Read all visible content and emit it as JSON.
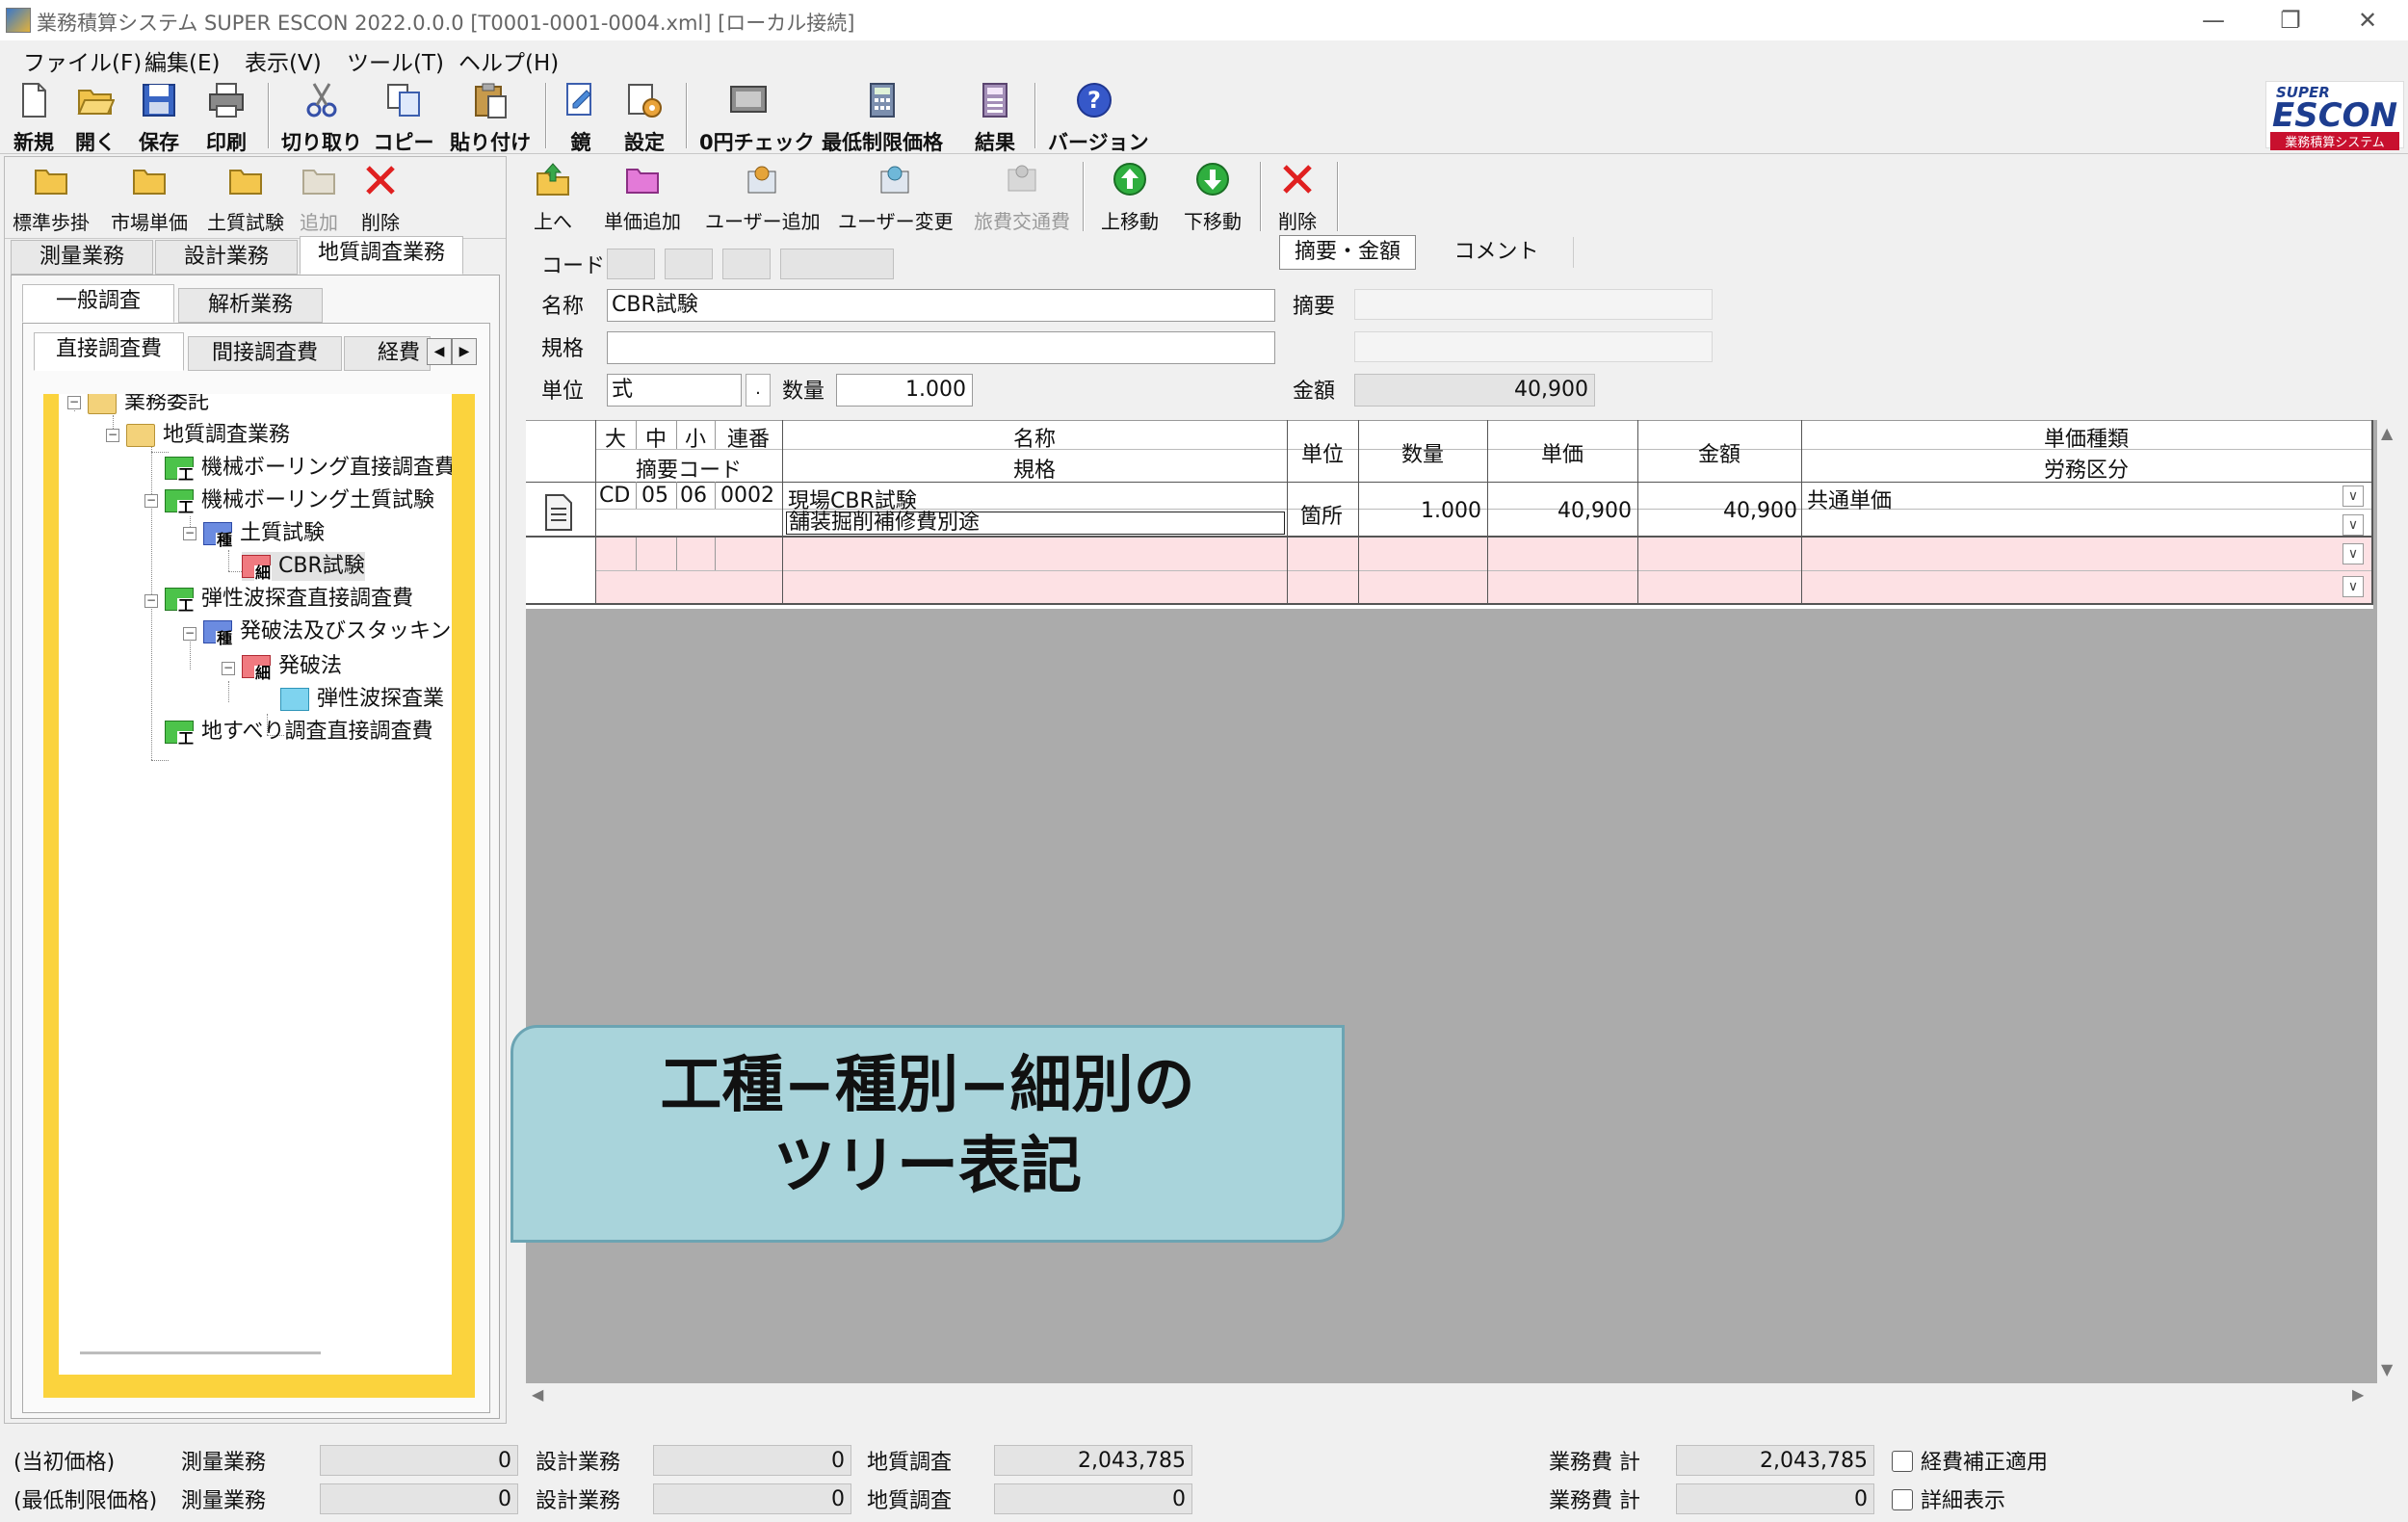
{
  "window": {
    "title": "業務積算システム SUPER ESCON 2022.0.0.0 [T0001-0001-0004.xml] [ローカル接続]",
    "controls": {
      "minimize": "—",
      "restore": "❐",
      "close": "✕"
    }
  },
  "menu": [
    "ファイル(F)",
    "編集(E)",
    "表示(V)",
    "ツール(T)",
    "ヘルプ(H)"
  ],
  "toolbar": [
    {
      "label": "新規",
      "icon": "new-file-icon"
    },
    {
      "label": "開く",
      "icon": "open-folder-icon"
    },
    {
      "label": "保存",
      "icon": "save-icon"
    },
    {
      "label": "印刷",
      "icon": "print-icon"
    },
    {
      "label": "切り取り",
      "icon": "scissors-icon"
    },
    {
      "label": "コピー",
      "icon": "copy-icon"
    },
    {
      "label": "貼り付け",
      "icon": "paste-icon"
    },
    {
      "label": "鏡",
      "icon": "mirror-icon"
    },
    {
      "label": "設定",
      "icon": "settings-icon"
    },
    {
      "label": "0円チェック",
      "icon": "zero-yen-check-icon"
    },
    {
      "label": "最低制限価格",
      "icon": "calculator-icon"
    },
    {
      "label": "結果",
      "icon": "result-icon"
    },
    {
      "label": "バージョン",
      "icon": "help-icon"
    }
  ],
  "logo": {
    "line1": "SUPER",
    "line2": "ESCON",
    "line3": "業務積算システム"
  },
  "left": {
    "subtoolbar": [
      {
        "label": "標準歩掛",
        "icon": "folder-icon",
        "disabled": false
      },
      {
        "label": "市場単価",
        "icon": "folder-icon",
        "disabled": false
      },
      {
        "label": "土質試験",
        "icon": "folder-icon",
        "disabled": false
      },
      {
        "label": "追加",
        "icon": "folder-icon",
        "disabled": true
      },
      {
        "label": "削除",
        "icon": "delete-icon",
        "disabled": false
      }
    ],
    "tabs1": [
      "測量業務",
      "設計業務",
      "地質調査業務"
    ],
    "tabs2": [
      "一般調査",
      "解析業務"
    ],
    "tabs3": [
      "直接調査費",
      "間接調査費",
      "経費"
    ],
    "tree": [
      {
        "label": "業務委託",
        "kind": "folder",
        "mark": ""
      },
      {
        "label": "地質調査業務",
        "kind": "folder",
        "mark": ""
      },
      {
        "label": "機械ボーリング直接調査費",
        "kind": "green",
        "mark": "工"
      },
      {
        "label": "機械ボーリング土質試験",
        "kind": "green",
        "mark": "工"
      },
      {
        "label": "土質試験",
        "kind": "blue",
        "mark": "種"
      },
      {
        "label": "CBR試験",
        "kind": "red",
        "mark": "細"
      },
      {
        "label": "弾性波探査直接調査費",
        "kind": "green",
        "mark": "工"
      },
      {
        "label": "発破法及びスタッキング",
        "kind": "blue",
        "mark": "種"
      },
      {
        "label": "発破法",
        "kind": "red",
        "mark": "細"
      },
      {
        "label": "弾性波探査業",
        "kind": "lblue",
        "mark": ""
      },
      {
        "label": "地すべり調査直接調査費",
        "kind": "green",
        "mark": "工"
      }
    ]
  },
  "right": {
    "toolbar": [
      {
        "label": "上へ",
        "icon": "up-folder-icon",
        "disabled": false
      },
      {
        "label": "単価追加",
        "icon": "folder-add-icon",
        "disabled": false
      },
      {
        "label": "ユーザー追加",
        "icon": "user-add-icon",
        "disabled": false
      },
      {
        "label": "ユーザー変更",
        "icon": "user-edit-icon",
        "disabled": false
      },
      {
        "label": "旅費交通費",
        "icon": "travel-icon",
        "disabled": true
      },
      {
        "label": "上移動",
        "icon": "arrow-up-icon",
        "disabled": false
      },
      {
        "label": "下移動",
        "icon": "arrow-down-icon",
        "disabled": false
      },
      {
        "label": "削除",
        "icon": "delete-icon",
        "disabled": false
      }
    ],
    "form": {
      "code_label": "コード",
      "name_label": "名称",
      "name_value": "CBR試験",
      "spec_label": "規格",
      "spec_value": "",
      "unit_label": "単位",
      "unit_value": "式",
      "qty_label": "数量",
      "qty_value": "1.000",
      "tabs": [
        "摘要・金額",
        "コメント"
      ],
      "summary_label": "摘要",
      "amount_label": "金額",
      "amount_value": "40,900"
    },
    "grid": {
      "headers": {
        "dai": "大",
        "chu": "中",
        "sho": "小",
        "renban": "連番",
        "code": "摘要コード",
        "name": "名称",
        "spec": "規格",
        "unit": "単位",
        "qty": "数量",
        "price": "単価",
        "amount": "金額",
        "ptype": "単価種類",
        "labor": "労務区分"
      },
      "row": {
        "dai": "CD",
        "chu": "05",
        "sho": "06",
        "renban": "0002",
        "name": "現場CBR試験",
        "spec": "舗装掘削補修費別途",
        "unit": "箇所",
        "qty": "1.000",
        "price": "40,900",
        "amount": "40,900",
        "ptype": "共通単価",
        "labor": ""
      }
    }
  },
  "callout": {
    "line1": "工種−種別−細別の",
    "line2": "ツリー表記"
  },
  "status": {
    "row1": {
      "label": "(当初価格)",
      "survey_label": "測量業務",
      "survey": "0",
      "design_label": "設計業務",
      "design": "0",
      "geo_label": "地質調査",
      "geo": "2,043,785",
      "total_label": "業務費 計",
      "total": "2,043,785",
      "check_label": "経費補正適用"
    },
    "row2": {
      "label": "(最低制限価格)",
      "survey_label": "測量業務",
      "survey": "0",
      "design_label": "設計業務",
      "design": "0",
      "geo_label": "地質調査",
      "geo": "0",
      "total_label": "業務費 計",
      "total": "0",
      "check_label": "詳細表示"
    }
  }
}
